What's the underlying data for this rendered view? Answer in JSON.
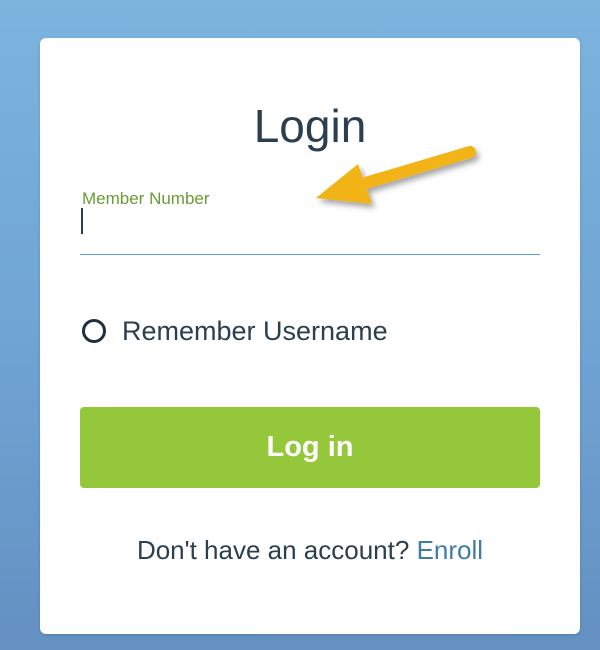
{
  "login_card": {
    "title": "Login",
    "member_number": {
      "label": "Member Number",
      "value": "",
      "placeholder": ""
    },
    "remember": {
      "label": "Remember Username",
      "checked": false
    },
    "login_button": {
      "label": "Log in"
    },
    "enroll": {
      "prompt": "Don't have an account?",
      "link_label": "Enroll"
    }
  },
  "annotation": {
    "icon": "arrow-icon",
    "color": "#f2b319"
  },
  "colors": {
    "background": "#6fa3d3",
    "card": "#ffffff",
    "accent_green": "#94c83a",
    "label_green": "#6c9a37",
    "underline_blue": "#5d9ecf",
    "link": "#3f7ea0",
    "text": "#2b3f4f"
  }
}
